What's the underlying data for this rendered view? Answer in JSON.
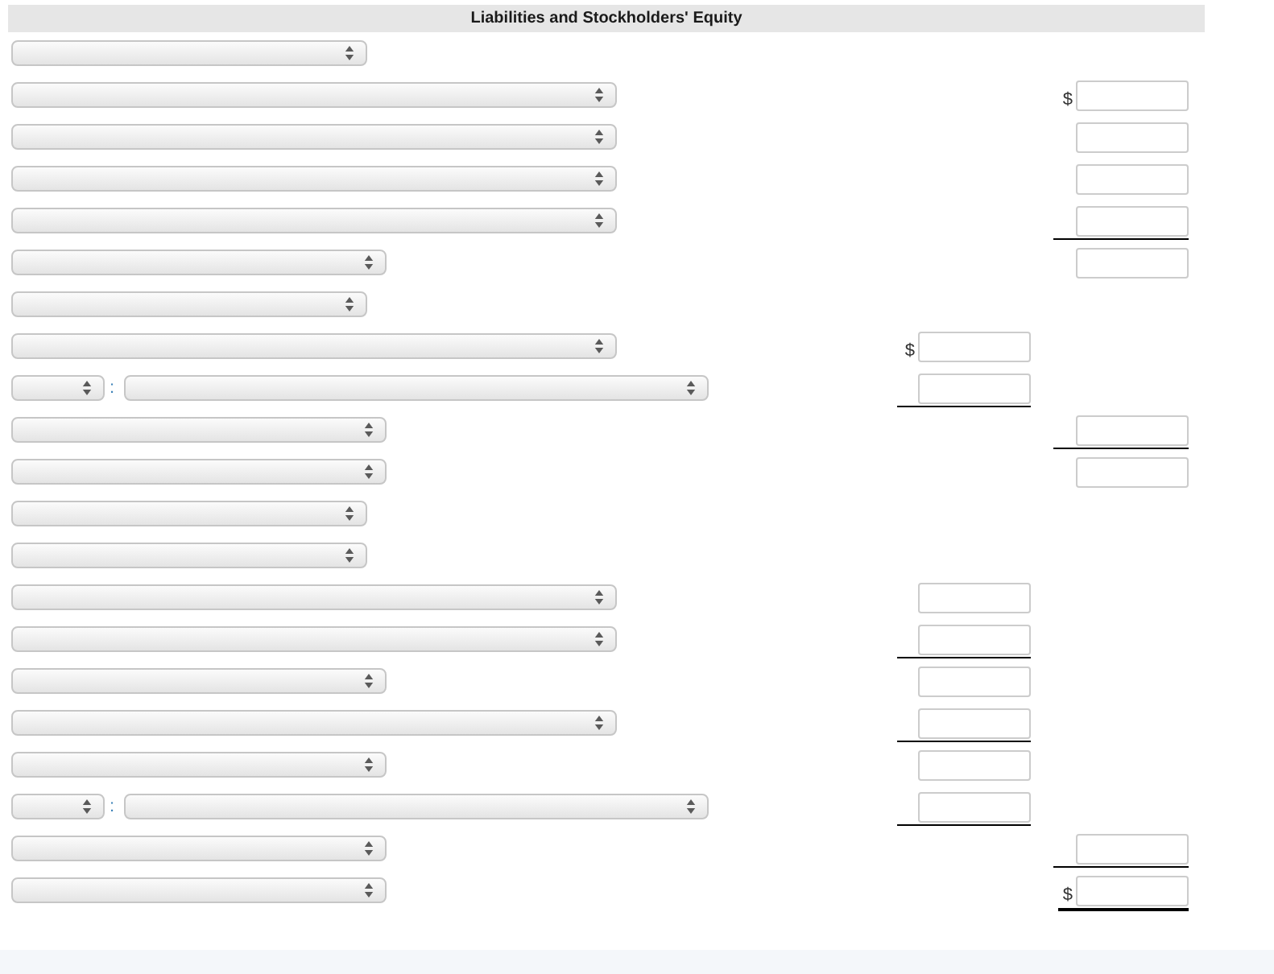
{
  "heading": "Liabilities and Stockholders' Equity",
  "rows": [
    {
      "kind": "select"
    },
    {
      "kind": "select",
      "amount": {
        "kind": "outer",
        "currency": "$",
        "underlined": false,
        "double_underlined": false
      }
    },
    {
      "kind": "select",
      "amount": {
        "kind": "outer",
        "underlined": false,
        "double_underlined": false
      }
    },
    {
      "kind": "select",
      "amount": {
        "kind": "outer",
        "underlined": false,
        "double_underlined": false
      }
    },
    {
      "kind": "select",
      "amount": {
        "kind": "outer",
        "underlined": true,
        "double_underlined": false
      }
    },
    {
      "kind": "select",
      "amount": {
        "kind": "outer",
        "underlined": false,
        "double_underlined": false
      }
    },
    {
      "kind": "select"
    },
    {
      "kind": "select",
      "amount": {
        "kind": "inner",
        "currency": "$",
        "underlined": false,
        "double_underlined": false
      }
    },
    {
      "kind": "select_pair",
      "separator": ":",
      "amount": {
        "kind": "inner",
        "underlined": true,
        "double_underlined": false
      }
    },
    {
      "kind": "select",
      "amount": {
        "kind": "outer",
        "underlined": true,
        "double_underlined": false
      }
    },
    {
      "kind": "select",
      "amount": {
        "kind": "outer",
        "underlined": false,
        "double_underlined": false
      }
    },
    {
      "kind": "select"
    },
    {
      "kind": "select"
    },
    {
      "kind": "select",
      "amount": {
        "kind": "inner",
        "underlined": false,
        "double_underlined": false
      }
    },
    {
      "kind": "select",
      "amount": {
        "kind": "inner",
        "underlined": true,
        "double_underlined": false
      }
    },
    {
      "kind": "select",
      "amount": {
        "kind": "inner",
        "underlined": false,
        "double_underlined": false
      }
    },
    {
      "kind": "select",
      "amount": {
        "kind": "inner",
        "underlined": true,
        "double_underlined": false
      }
    },
    {
      "kind": "select",
      "amount": {
        "kind": "inner",
        "underlined": false,
        "double_underlined": false
      }
    },
    {
      "kind": "select_pair",
      "separator": ":",
      "amount": {
        "kind": "inner",
        "underlined": true,
        "double_underlined": false
      }
    },
    {
      "kind": "select",
      "amount": {
        "kind": "outer",
        "underlined": true,
        "double_underlined": false
      }
    },
    {
      "kind": "select",
      "amount": {
        "kind": "outer",
        "currency": "$",
        "underlined": false,
        "double_underlined": true
      }
    }
  ]
}
